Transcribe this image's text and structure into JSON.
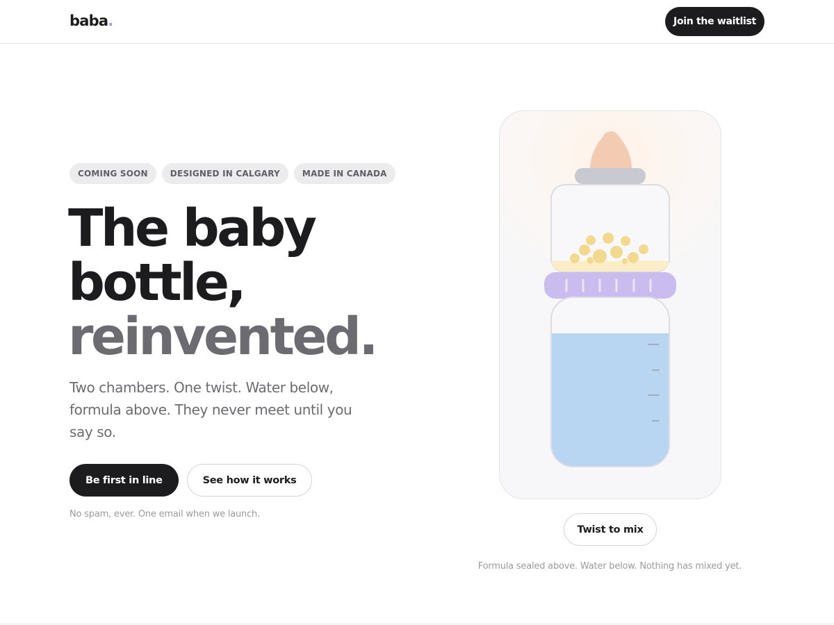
{
  "header": {
    "logo_text": "baba",
    "logo_dot": ".",
    "waitlist_label": "Join the waitlist"
  },
  "hero": {
    "badges": [
      "COMING SOON",
      "DESIGNED IN CALGARY",
      "MADE IN CANADA"
    ],
    "headline_line1": "The baby",
    "headline_line2": "bottle,",
    "headline_line3": "reinvented.",
    "subcopy": "Two chambers. One twist. Water below, formula above. They never meet until you say so.",
    "primary_cta": "Be first in line",
    "secondary_cta": "See how it works",
    "fineprint": "No spam, ever. One email when we launch."
  },
  "bottle": {
    "twist_label": "Twist to mix",
    "status_text": "Formula sealed above. Water below. Nothing has mixed yet.",
    "colors": {
      "nipple": "#f3cbb3",
      "collar": "#c9cad1",
      "formula": "#f2d98e",
      "ring": "#cbbcf0",
      "water": "#b8d5f2"
    },
    "icons": [
      "baby-bottle-illustration"
    ]
  }
}
